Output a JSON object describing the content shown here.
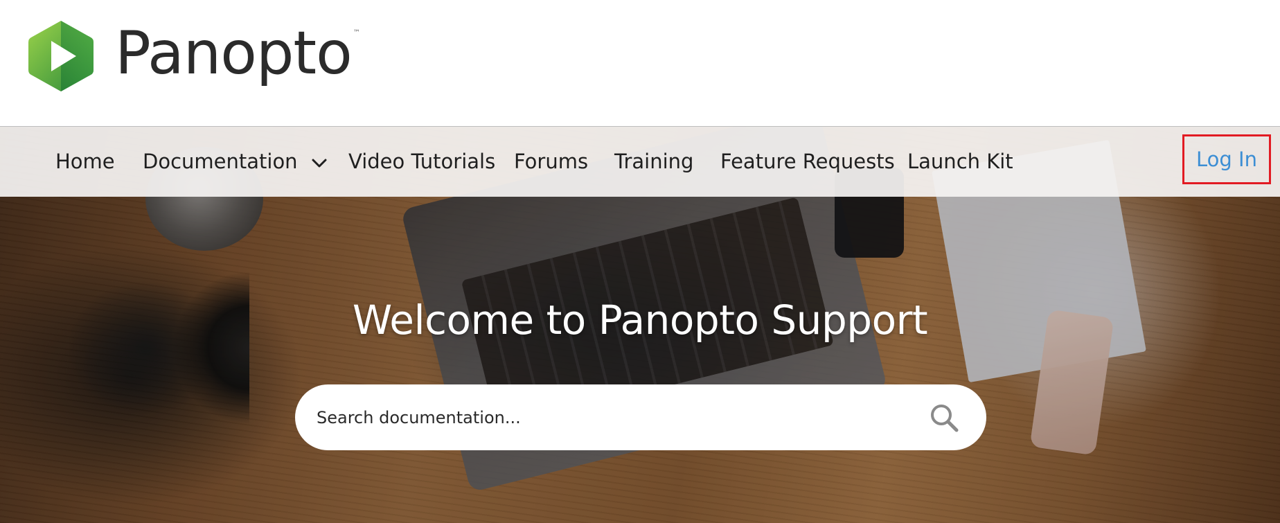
{
  "brand": {
    "name": "Panopto",
    "trademark": "™",
    "logo_colors": {
      "green_light": "#8cc63f",
      "green_dark": "#2e8b3a",
      "play_white": "#ffffff"
    }
  },
  "nav": {
    "items": [
      {
        "label": "Home"
      },
      {
        "label": "Documentation",
        "has_dropdown": true
      },
      {
        "label": "Video Tutorials"
      },
      {
        "label": "Forums"
      },
      {
        "label": "Training"
      },
      {
        "label": "Feature Requests"
      },
      {
        "label": "Launch Kit"
      }
    ],
    "login_label": "Log In",
    "login_color": "#3c8ed4",
    "highlight_color": "#e21b23"
  },
  "hero": {
    "title": "Welcome to Panopto Support",
    "search": {
      "placeholder": "Search documentation...",
      "value": ""
    }
  },
  "icons": {
    "chevron": "chevron-down-icon",
    "search": "search-icon"
  }
}
